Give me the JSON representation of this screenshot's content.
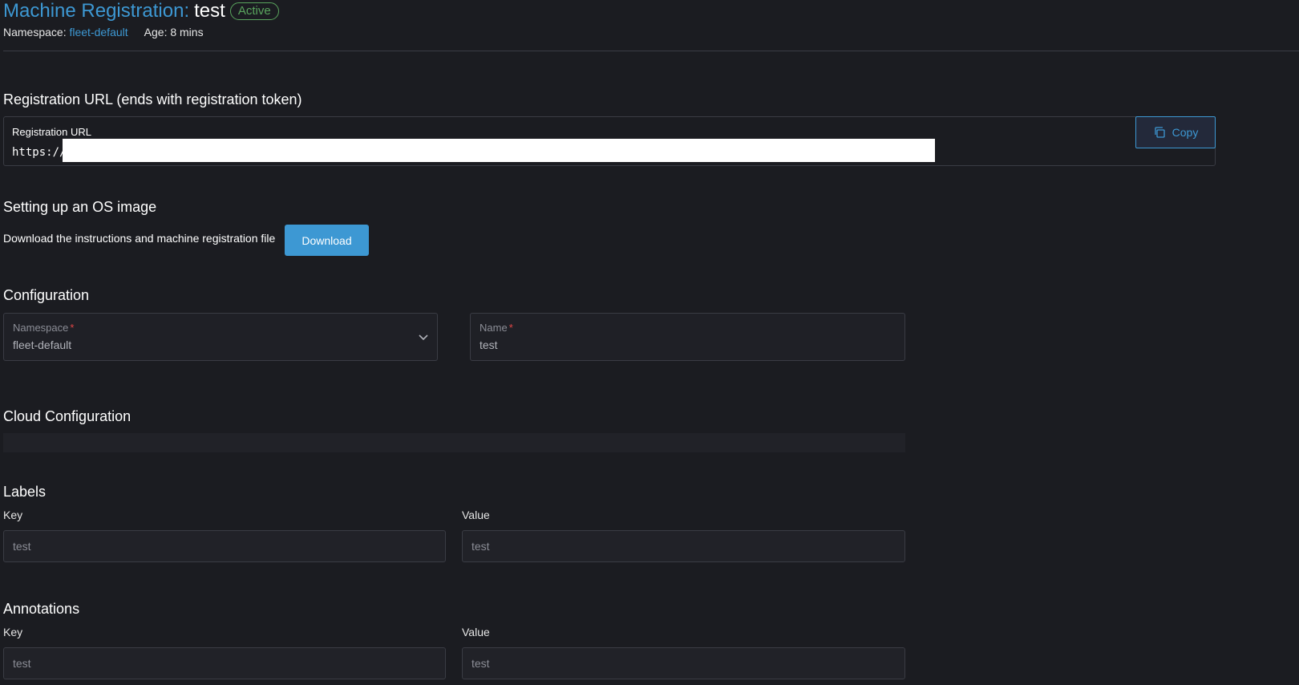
{
  "header": {
    "type_label": "Machine Registration:",
    "name": "test",
    "status": "Active",
    "namespace_label": "Namespace:",
    "namespace_value": "fleet-default",
    "age": "Age: 8 mins"
  },
  "registration": {
    "heading": "Registration URL (ends with registration token)",
    "field_label": "Registration URL",
    "url_prefix": "https://",
    "copy_label": "Copy"
  },
  "os_image": {
    "heading": "Setting up an OS image",
    "text": "Download the instructions and machine registration file",
    "download_label": "Download"
  },
  "configuration": {
    "heading": "Configuration",
    "namespace_label": "Namespace",
    "namespace_value": "fleet-default",
    "name_label": "Name",
    "name_value": "test",
    "required_mark": "*"
  },
  "cloud": {
    "heading": "Cloud Configuration"
  },
  "labels": {
    "heading": "Labels",
    "key_header": "Key",
    "value_header": "Value",
    "key_value": "test",
    "value_value": "test"
  },
  "annotations": {
    "heading": "Annotations",
    "key_header": "Key",
    "value_header": "Value",
    "key_value": "test",
    "value_value": "test"
  },
  "colors": {
    "accent": "#3d98d3",
    "active": "#5aa55e",
    "background": "#1b1c21",
    "required": "#e04646"
  }
}
